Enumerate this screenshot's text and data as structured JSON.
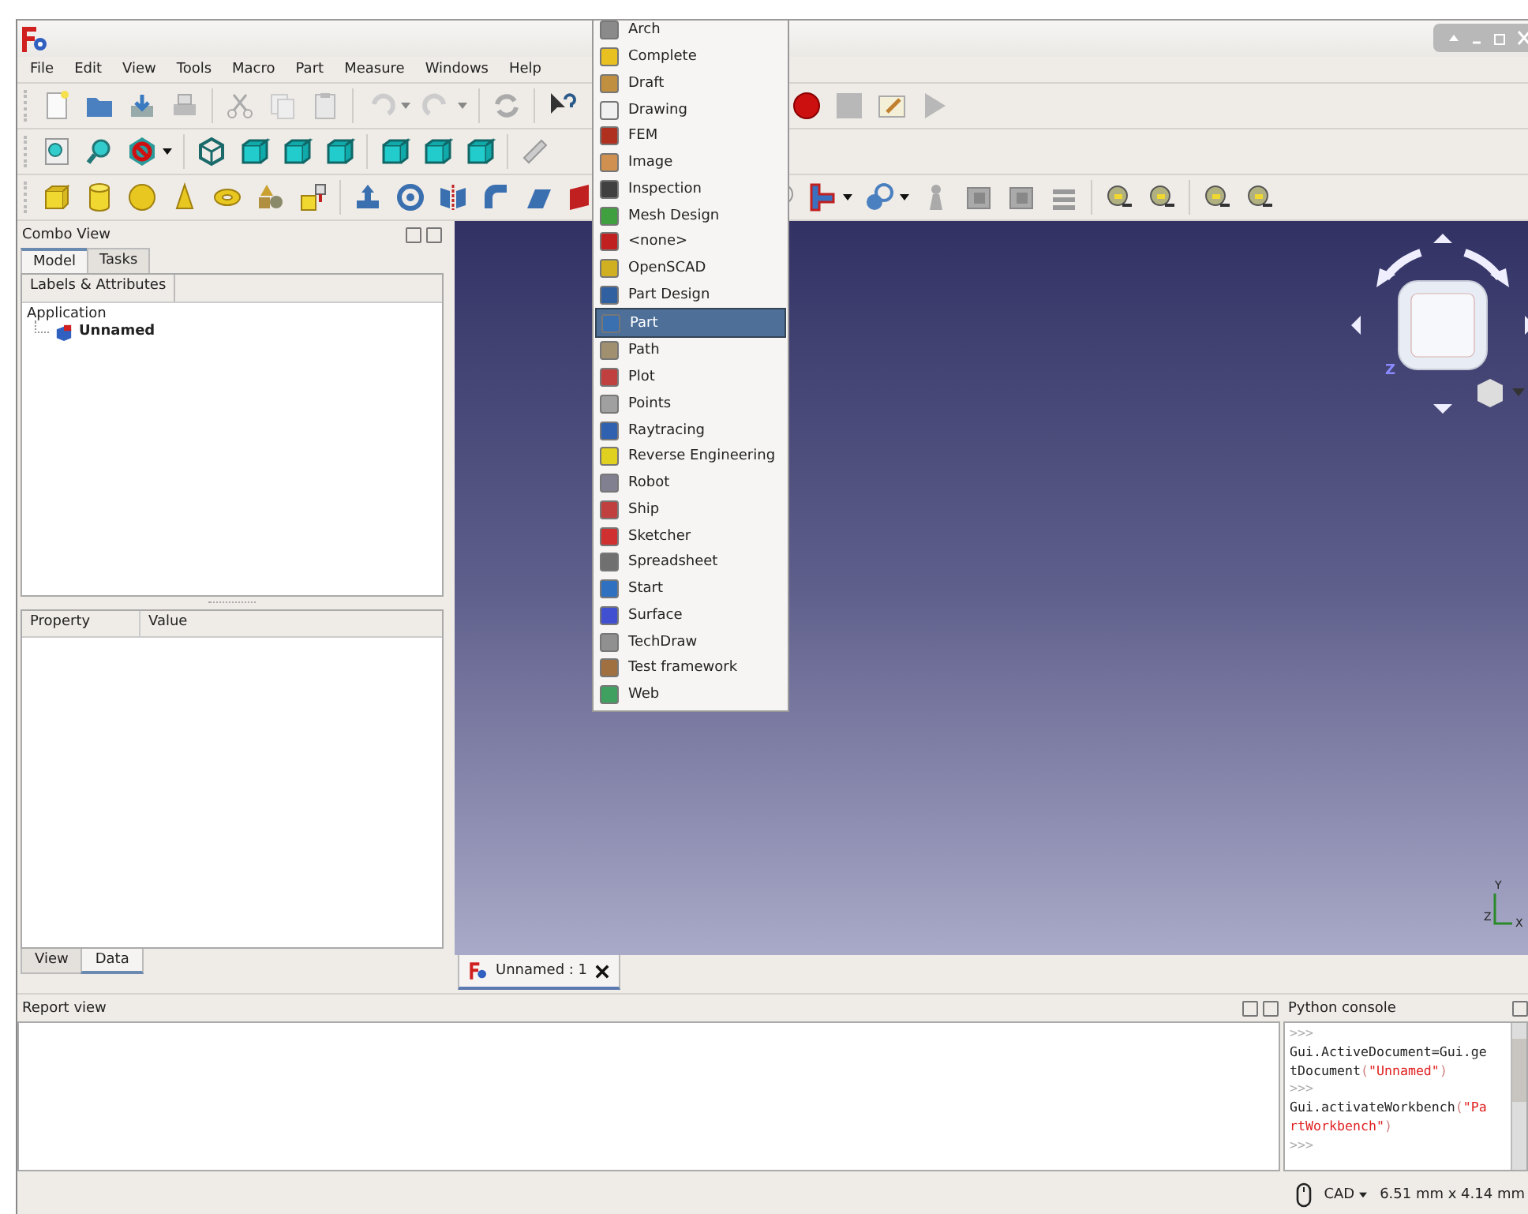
{
  "menu_bar": [
    "File",
    "Edit",
    "View",
    "Tools",
    "Macro",
    "Part",
    "Measure",
    "Windows",
    "Help"
  ],
  "workbench_menu": [
    {
      "label": "Arch",
      "selected": false
    },
    {
      "label": "Complete",
      "selected": false
    },
    {
      "label": "Draft",
      "selected": false
    },
    {
      "label": "Drawing",
      "selected": false
    },
    {
      "label": "FEM",
      "selected": false
    },
    {
      "label": "Image",
      "selected": false
    },
    {
      "label": "Inspection",
      "selected": false
    },
    {
      "label": "Mesh Design",
      "selected": false
    },
    {
      "label": "<none>",
      "selected": false
    },
    {
      "label": "OpenSCAD",
      "selected": false
    },
    {
      "label": "Part Design",
      "selected": false
    },
    {
      "label": "Part",
      "selected": true
    },
    {
      "label": "Path",
      "selected": false
    },
    {
      "label": "Plot",
      "selected": false
    },
    {
      "label": "Points",
      "selected": false
    },
    {
      "label": "Raytracing",
      "selected": false
    },
    {
      "label": "Reverse Engineering",
      "selected": false
    },
    {
      "label": "Robot",
      "selected": false
    },
    {
      "label": "Ship",
      "selected": false
    },
    {
      "label": "Sketcher",
      "selected": false
    },
    {
      "label": "Spreadsheet",
      "selected": false
    },
    {
      "label": "Start",
      "selected": false
    },
    {
      "label": "Surface",
      "selected": false
    },
    {
      "label": "TechDraw",
      "selected": false
    },
    {
      "label": "Test framework",
      "selected": false
    },
    {
      "label": "Web",
      "selected": false
    }
  ],
  "combo_view": {
    "title": "Combo View",
    "tabs": [
      {
        "label": "Model",
        "selected": true
      },
      {
        "label": "Tasks",
        "selected": false
      }
    ],
    "tree_header": "Labels & Attributes",
    "tree": [
      {
        "label": "Application",
        "children": [
          {
            "label": "Unnamed"
          }
        ]
      }
    ],
    "property_columns": [
      "Property",
      "Value"
    ],
    "bottom_tabs": [
      {
        "label": "View",
        "selected": false
      },
      {
        "label": "Data",
        "selected": true
      }
    ]
  },
  "viewport": {
    "cube_axis": "Z",
    "axis_labels": [
      "Y",
      "Z",
      "X"
    ]
  },
  "document_tabs": [
    {
      "label": "Unnamed : 1",
      "selected": true
    }
  ],
  "report_view": {
    "title": "Report view"
  },
  "python_console": {
    "title": "Python console",
    "lines": [
      [
        {
          "text": ">>>",
          "kind": "prompt"
        }
      ],
      [
        {
          "text": "Gui.ActiveDocument=Gui.ge",
          "kind": "code"
        }
      ],
      [
        {
          "text": "tDocument",
          "kind": "code"
        },
        {
          "text": "(",
          "kind": "punct"
        },
        {
          "text": "\"Unnamed\"",
          "kind": "string"
        },
        {
          "text": ")",
          "kind": "punct"
        }
      ],
      [
        {
          "text": ">>>",
          "kind": "prompt"
        }
      ],
      [
        {
          "text": "Gui.activateWorkbench",
          "kind": "code"
        },
        {
          "text": "(",
          "kind": "punct"
        },
        {
          "text": "\"Pa",
          "kind": "string"
        }
      ],
      [
        {
          "text": "rtWorkbench\"",
          "kind": "string"
        },
        {
          "text": ")",
          "kind": "punct"
        }
      ],
      [
        {
          "text": ">>>",
          "kind": "prompt"
        }
      ]
    ]
  },
  "status_bar": {
    "navigation": "CAD",
    "dimensions": "6.51 mm x 4.14 mm"
  }
}
